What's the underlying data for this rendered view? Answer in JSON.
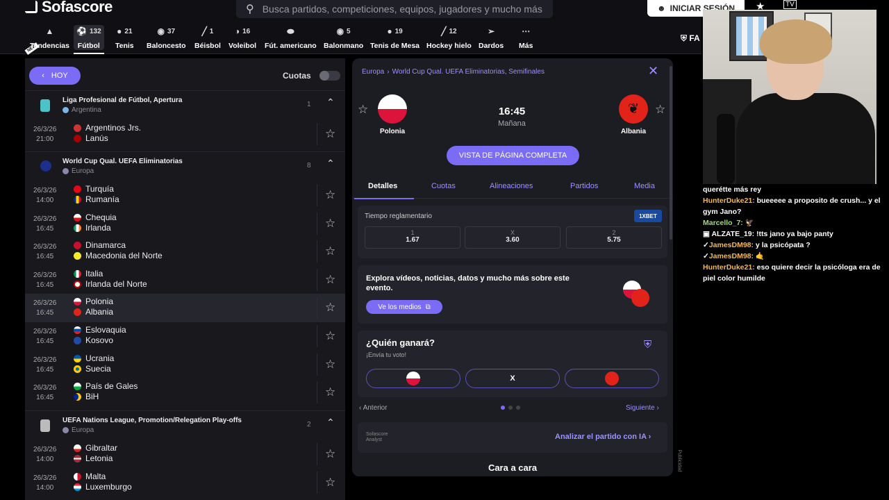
{
  "topbar": {
    "brand": "Sofascore",
    "search_placeholder": "Busca partidos, competiciones, equipos, jugadores y mucho más",
    "login": "INICIAR SESIÓN",
    "tv": "TV",
    "fav_short": "FA"
  },
  "sports": [
    {
      "label": "Tendencias",
      "count": ""
    },
    {
      "label": "Fútbol",
      "count": "132"
    },
    {
      "label": "Tenis",
      "count": "21"
    },
    {
      "label": "Baloncesto",
      "count": "37"
    },
    {
      "label": "Béisbol",
      "count": "1"
    },
    {
      "label": "Voleibol",
      "count": "16"
    },
    {
      "label": "Fút. americano",
      "count": ""
    },
    {
      "label": "Balonmano",
      "count": "5"
    },
    {
      "label": "Tenis de Mesa",
      "count": "19"
    },
    {
      "label": "Hockey hielo",
      "count": "12"
    },
    {
      "label": "Dardos",
      "count": ""
    },
    {
      "label": "Más",
      "count": ""
    }
  ],
  "left": {
    "hoy": "HOY",
    "cuotas": "Cuotas",
    "leagues": [
      {
        "name": "Liga Profesional de Fútbol, Apertura",
        "country": "Argentina",
        "count": "1",
        "events": [
          {
            "date": "26/3/26",
            "time": "21:00",
            "home": "Argentinos Jrs.",
            "away": "Lanús"
          }
        ]
      },
      {
        "name": "World Cup Qual. UEFA Eliminatorias",
        "country": "Europa",
        "count": "8",
        "events": [
          {
            "date": "26/3/26",
            "time": "14:00",
            "home": "Turquía",
            "away": "Rumanía"
          },
          {
            "date": "26/3/26",
            "time": "16:45",
            "home": "Chequia",
            "away": "Irlanda"
          },
          {
            "date": "26/3/26",
            "time": "16:45",
            "home": "Dinamarca",
            "away": "Macedonia del Norte"
          },
          {
            "date": "26/3/26",
            "time": "16:45",
            "home": "Italia",
            "away": "Irlanda del Norte"
          },
          {
            "date": "26/3/26",
            "time": "16:45",
            "home": "Polonia",
            "away": "Albania"
          },
          {
            "date": "26/3/26",
            "time": "16:45",
            "home": "Eslovaquia",
            "away": "Kosovo"
          },
          {
            "date": "26/3/26",
            "time": "16:45",
            "home": "Ucrania",
            "away": "Suecia"
          },
          {
            "date": "26/3/26",
            "time": "16:45",
            "home": "País de Gales",
            "away": "BiH"
          }
        ]
      },
      {
        "name": "UEFA Nations League, Promotion/Relegation Play-offs",
        "country": "Europa",
        "count": "2",
        "events": [
          {
            "date": "26/3/26",
            "time": "14:00",
            "home": "Gibraltar",
            "away": "Letonia"
          },
          {
            "date": "26/3/26",
            "time": "14:00",
            "home": "Malta",
            "away": "Luxemburgo"
          }
        ]
      }
    ]
  },
  "panel": {
    "breadcrumb_1": "Europa",
    "breadcrumb_2": "World Cup Qual. UEFA Eliminatorias, Semifinales",
    "home": "Polonia",
    "away": "Albania",
    "time": "16:45",
    "day": "Mañana",
    "full_page": "VISTA DE PÁGINA COMPLETA",
    "tabs": [
      "Detalles",
      "Cuotas",
      "Alineaciones",
      "Partidos",
      "Media"
    ],
    "odds_title": "Tiempo reglamentario",
    "bookmaker": "1XBET",
    "odds": [
      {
        "k": "1",
        "v": "1.67"
      },
      {
        "k": "X",
        "v": "3.60"
      },
      {
        "k": "2",
        "v": "5.75"
      }
    ],
    "media_text": "Explora vídeos, noticias, datos y mucho más sobre este evento.",
    "media_btn": "Ve los medios",
    "vote_title": "¿Quién ganará?",
    "vote_sub": "¡Envía tu voto!",
    "vote_x": "X",
    "prev": "Anterior",
    "next": "Siguiente",
    "analyst_logo_1": "Sofascore",
    "analyst_logo_2": "Analyst",
    "analyst_link": "Analizar el partido con IA",
    "h2h": "Cara a cara",
    "ad": "Publicidad"
  },
  "chat": [
    {
      "user": "",
      "text": "querétte más rey"
    },
    {
      "user": "HunterDuke21:",
      "text": " bueeeee a proposito de crush... y el gym Jano?"
    },
    {
      "user": "Marcello_7:",
      "text": " 🦅"
    },
    {
      "user": "ALZATE_19:",
      "text": " !tts jano ya bajo panty"
    },
    {
      "user": "JamesDM98:",
      "text": " y la psicópata ?"
    },
    {
      "user": "JamesDM98:",
      "text": " 🤙"
    },
    {
      "user": "HunterDuke21:",
      "text": " eso quiere decir la psicóloga era de piel color humilde"
    }
  ],
  "colors": {
    "accent": "#7b6cf6",
    "accent_text": "#9d92ff",
    "poland": "#e8333c",
    "albania": "#e2231a"
  }
}
